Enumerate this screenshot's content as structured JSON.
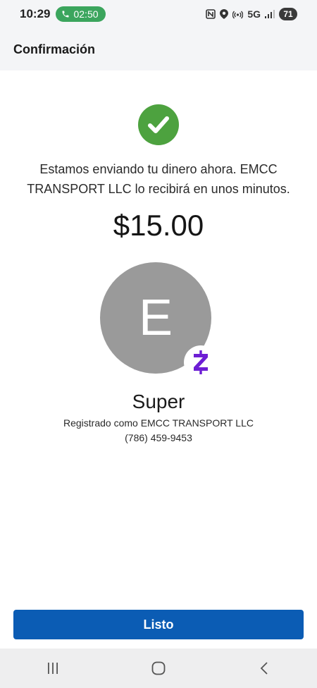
{
  "status_bar": {
    "time": "10:29",
    "call_timer": "02:50",
    "network": "5G",
    "battery": "71"
  },
  "header": {
    "title": "Confirmación"
  },
  "confirmation": {
    "message": "Estamos enviando tu dinero ahora. EMCC TRANSPORT LLC lo recibirá en unos minutos.",
    "amount": "$15.00",
    "avatar_letter": "E",
    "recipient_name": "Super",
    "registered_as": "Registrado como EMCC TRANSPORT LLC",
    "phone": "(786) 459-9453"
  },
  "actions": {
    "done_label": "Listo"
  },
  "colors": {
    "accent": "#0b5cb4",
    "success": "#4da23f",
    "zelle": "#6d1ed4",
    "call_pill": "#3ba55d"
  }
}
